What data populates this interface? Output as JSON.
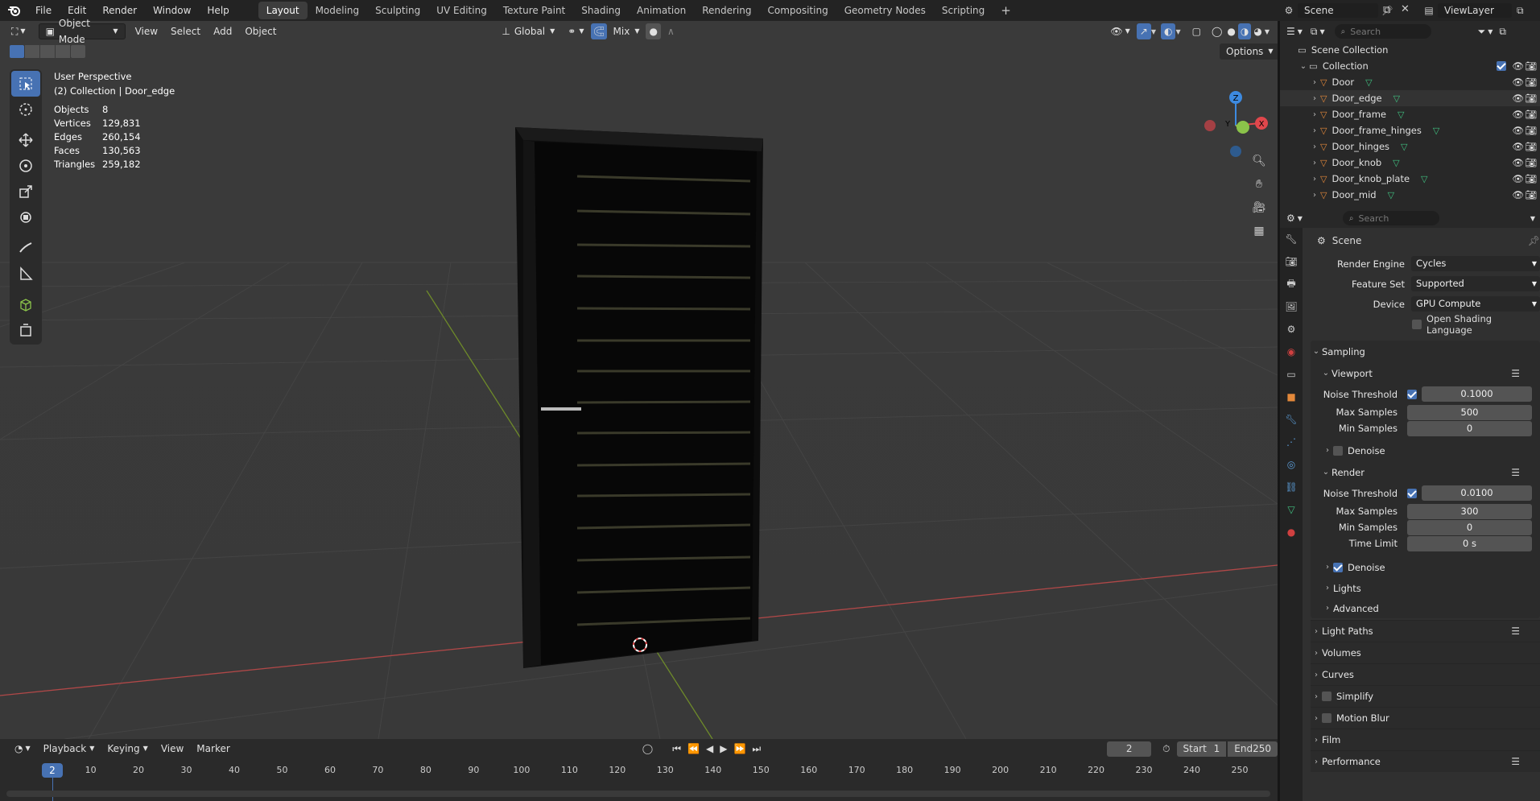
{
  "topbar": {
    "menus": [
      "File",
      "Edit",
      "Render",
      "Window",
      "Help"
    ],
    "workspaces": [
      "Layout",
      "Modeling",
      "Sculpting",
      "UV Editing",
      "Texture Paint",
      "Shading",
      "Animation",
      "Rendering",
      "Compositing",
      "Geometry Nodes",
      "Scripting"
    ],
    "active_workspace": "Layout",
    "add_tab": "+",
    "scene_name": "Scene",
    "view_layer": "ViewLayer"
  },
  "viewport": {
    "mode": "Object Mode",
    "menus": [
      "View",
      "Select",
      "Add",
      "Object"
    ],
    "transform_orientation": "Global",
    "snap_mode": "Mix",
    "options_label": "Options",
    "perspective_label": "User Perspective",
    "collection_label": "(2) Collection | Door_edge",
    "stats": [
      {
        "label": "Objects",
        "value": "8"
      },
      {
        "label": "Vertices",
        "value": "129,831"
      },
      {
        "label": "Edges",
        "value": "260,154"
      },
      {
        "label": "Faces",
        "value": "130,563"
      },
      {
        "label": "Triangles",
        "value": "259,182"
      }
    ],
    "gizmo": {
      "z": "Z",
      "y": "Y",
      "x": "X"
    }
  },
  "timeline": {
    "menus": [
      "Playback",
      "Keying",
      "View",
      "Marker"
    ],
    "current_frame": "2",
    "start_label": "Start",
    "start_value": "1",
    "end_label": "End",
    "end_value": "250",
    "ruler": [
      "2",
      "10",
      "20",
      "30",
      "40",
      "50",
      "60",
      "70",
      "80",
      "90",
      "100",
      "110",
      "120",
      "130",
      "140",
      "150",
      "160",
      "170",
      "180",
      "190",
      "200",
      "210",
      "220",
      "230",
      "240",
      "250"
    ]
  },
  "outliner": {
    "search_placeholder": "Search",
    "root": "Scene Collection",
    "collection": "Collection",
    "objects": [
      "Door",
      "Door_edge",
      "Door_frame",
      "Door_frame_hinges",
      "Door_hinges",
      "Door_knob",
      "Door_knob_plate",
      "Door_mid"
    ]
  },
  "properties": {
    "search_placeholder": "Search",
    "context": "Scene",
    "render_engine_label": "Render Engine",
    "render_engine": "Cycles",
    "feature_set_label": "Feature Set",
    "feature_set": "Supported",
    "device_label": "Device",
    "device": "GPU Compute",
    "osl_label": "Open Shading Language",
    "sampling": "Sampling",
    "viewport": "Viewport",
    "noise_threshold_label": "Noise Threshold",
    "max_samples_label": "Max Samples",
    "min_samples_label": "Min Samples",
    "time_limit_label": "Time Limit",
    "vp_noise_threshold": "0.1000",
    "vp_max_samples": "500",
    "vp_min_samples": "0",
    "denoise_label": "Denoise",
    "render": "Render",
    "r_noise_threshold": "0.0100",
    "r_max_samples": "300",
    "r_min_samples": "0",
    "r_time_limit": "0 s",
    "lights": "Lights",
    "advanced": "Advanced",
    "light_paths": "Light Paths",
    "volumes": "Volumes",
    "curves": "Curves",
    "simplify": "Simplify",
    "motion_blur": "Motion Blur",
    "film": "Film",
    "performance": "Performance"
  },
  "colors": {
    "accent": "#4772b3",
    "x_axis": "#e0474c",
    "y_axis": "#8bc34a",
    "z_axis": "#3d8ae0",
    "mesh_icon": "#e3883a",
    "data_icon": "#40c080"
  }
}
